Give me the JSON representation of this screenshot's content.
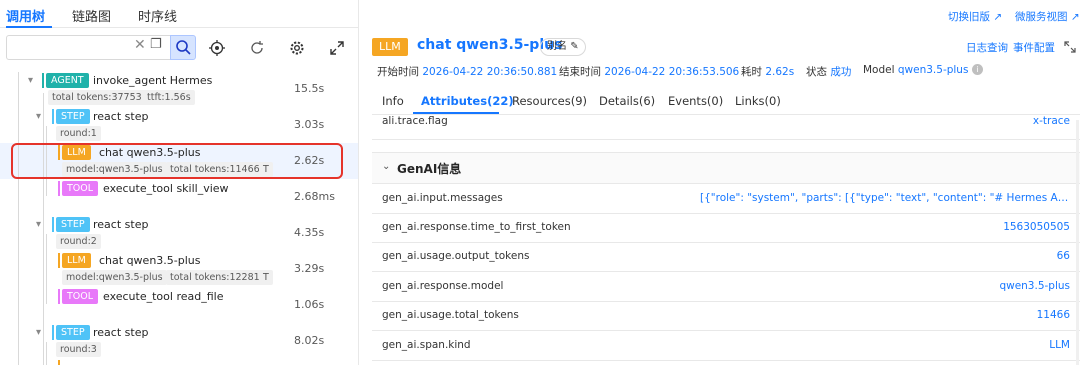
{
  "top_tabs": [
    {
      "label": "调用树"
    },
    {
      "label": "链路图"
    },
    {
      "label": "时序线"
    }
  ],
  "right_links": {
    "switch_old": "切换旧版",
    "microservice": "微服务视图"
  },
  "tree": {
    "nodes": [
      {
        "tag": "AGENT",
        "name": "invoke_agent Hermes",
        "chips": [
          "total tokens:37753",
          "ttft:1.56s"
        ],
        "duration": "15.5s"
      },
      {
        "tag": "STEP",
        "name": "react step",
        "chips": [
          "round:1"
        ],
        "duration": "3.03s"
      },
      {
        "tag": "LLM",
        "name": "chat qwen3.5-plus",
        "chips": [
          "model:qwen3.5-plus",
          "total tokens:11466",
          "T"
        ],
        "duration": "2.62s"
      },
      {
        "tag": "TOOL",
        "name": "execute_tool skill_view",
        "chips": [],
        "duration": "2.68ms"
      },
      {
        "tag": "STEP",
        "name": "react step",
        "chips": [
          "round:2"
        ],
        "duration": "4.35s"
      },
      {
        "tag": "LLM",
        "name": "chat qwen3.5-plus",
        "chips": [
          "model:qwen3.5-plus",
          "total tokens:12281",
          "T"
        ],
        "duration": "3.29s"
      },
      {
        "tag": "TOOL",
        "name": "execute_tool read_file",
        "chips": [],
        "duration": "1.06s"
      },
      {
        "tag": "STEP",
        "name": "react step",
        "chips": [
          "round:3"
        ],
        "duration": "8.02s"
      }
    ]
  },
  "detail": {
    "tag": "LLM",
    "title": "chat qwen3.5-plus",
    "alias": "别名",
    "links": {
      "log_query": "日志查询",
      "event_config": "事件配置"
    },
    "meta": [
      {
        "label": "开始时间",
        "value": "2026-04-22 20:36:50.881"
      },
      {
        "label": "结束时间",
        "value": "2026-04-22 20:36:53.506"
      },
      {
        "label": "耗时",
        "value": "2.62s"
      },
      {
        "label": "状态",
        "value": "成功"
      },
      {
        "label": "Model",
        "value": "qwen3.5-plus"
      }
    ],
    "tabs": [
      "Info",
      "Attributes(22)",
      "Resources(9)",
      "Details(6)",
      "Events(0)",
      "Links(0)"
    ],
    "top_row": {
      "key": "ali.trace.flag",
      "value": "x-trace"
    },
    "section_title": "GenAI信息",
    "attributes": [
      {
        "key": "gen_ai.input.messages",
        "value": "[{\"role\": \"system\", \"parts\": [{\"type\": \"text\", \"content\": \"# Hermes Agent Pe..."
      },
      {
        "key": "gen_ai.response.time_to_first_token",
        "value": "1563050505"
      },
      {
        "key": "gen_ai.usage.output_tokens",
        "value": "66"
      },
      {
        "key": "gen_ai.response.model",
        "value": "qwen3.5-plus"
      },
      {
        "key": "gen_ai.usage.total_tokens",
        "value": "11466"
      },
      {
        "key": "gen_ai.span.kind",
        "value": "LLM"
      }
    ]
  }
}
